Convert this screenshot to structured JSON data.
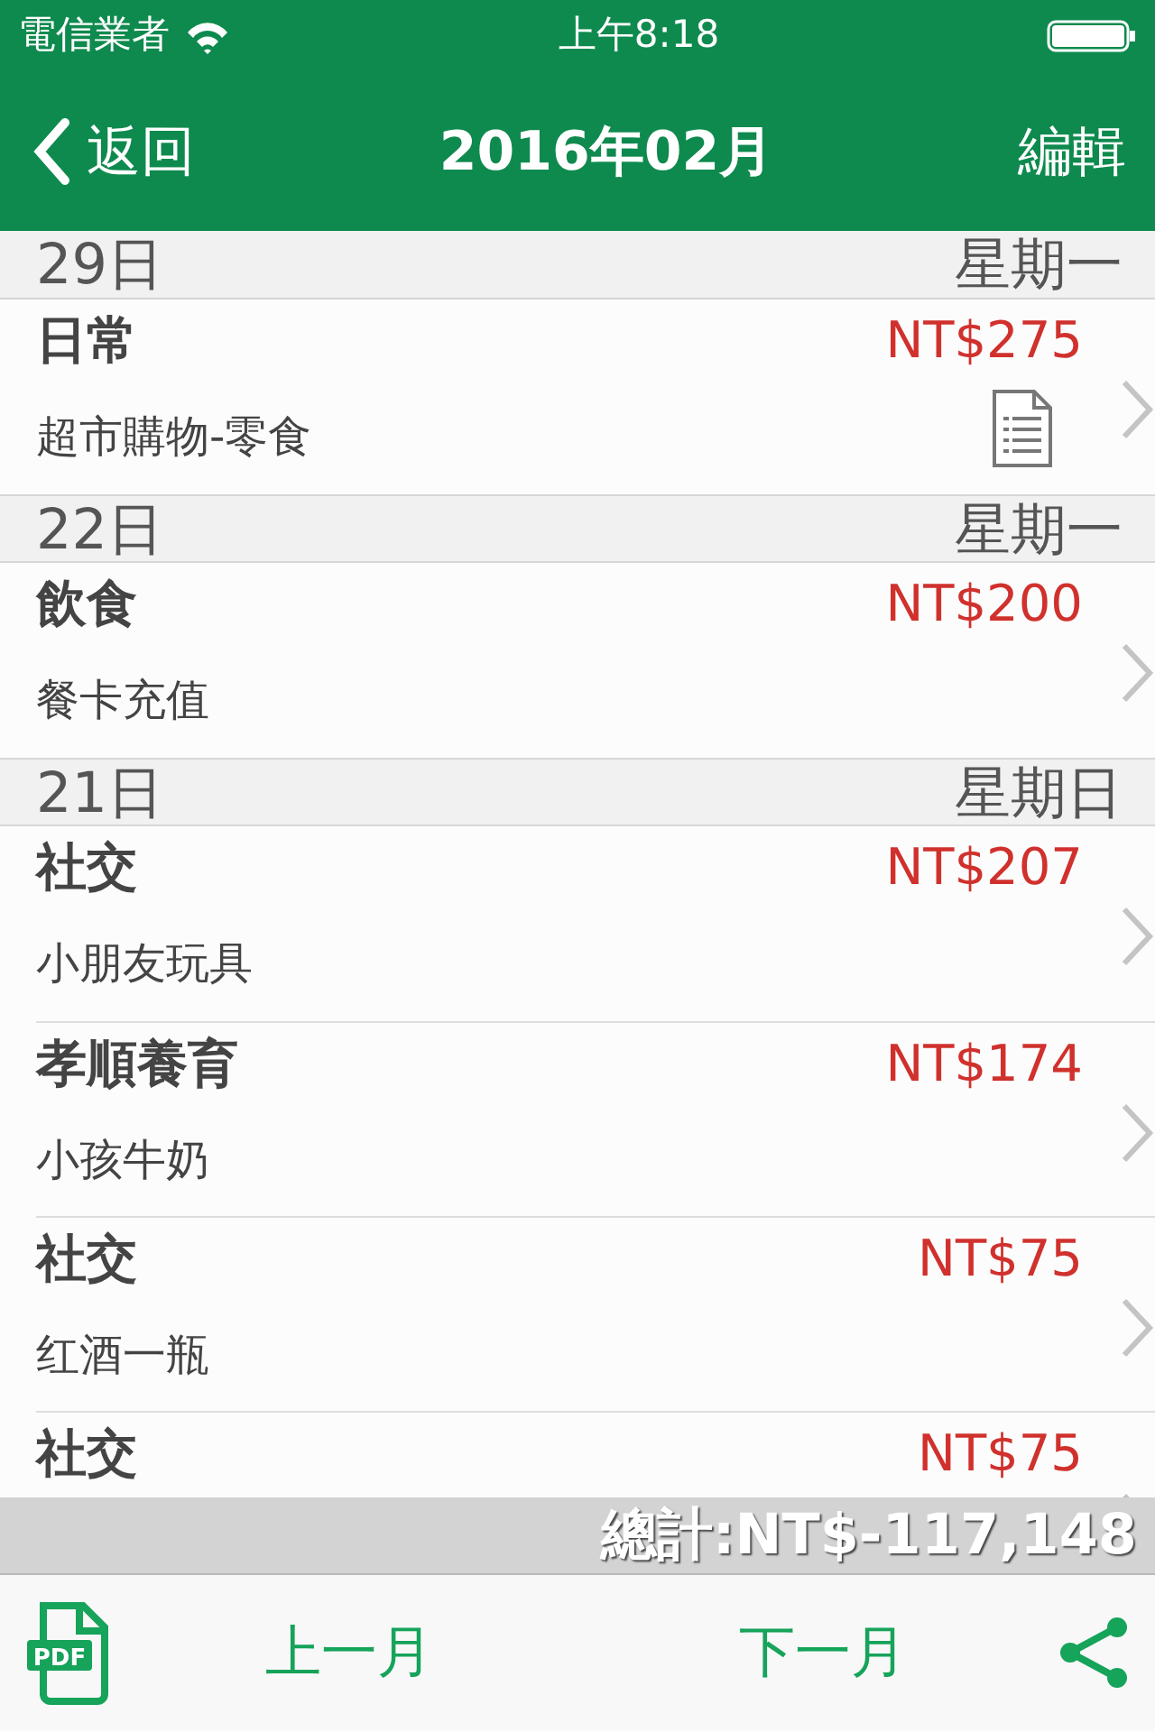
{
  "status_bar": {
    "carrier": "電信業者",
    "time": "上午8:18"
  },
  "nav": {
    "back": "返回",
    "title": "2016年02月",
    "action": "編輯"
  },
  "sections": [
    {
      "day": "29日",
      "weekday": "星期一",
      "entries": [
        {
          "category": "日常",
          "amount": "NT$275",
          "note": "超市購物-零食",
          "has_attachment": true
        }
      ]
    },
    {
      "day": "22日",
      "weekday": "星期一",
      "entries": [
        {
          "category": "飲食",
          "amount": "NT$200",
          "note": "餐卡充值",
          "has_attachment": false
        }
      ]
    },
    {
      "day": "21日",
      "weekday": "星期日",
      "entries": [
        {
          "category": "社交",
          "amount": "NT$207",
          "note": "小朋友玩具",
          "has_attachment": false
        },
        {
          "category": "孝順養育",
          "amount": "NT$174",
          "note": "小孩牛奶",
          "has_attachment": false
        },
        {
          "category": "社交",
          "amount": "NT$75",
          "note": "红酒一瓶",
          "has_attachment": false
        },
        {
          "category": "社交",
          "amount": "NT$75",
          "has_attachment": false
        }
      ]
    }
  ],
  "total": "總計:NT$-117,148",
  "toolbar": {
    "pdf_label": "PDF",
    "prev": "上一月",
    "next": "下一月"
  }
}
